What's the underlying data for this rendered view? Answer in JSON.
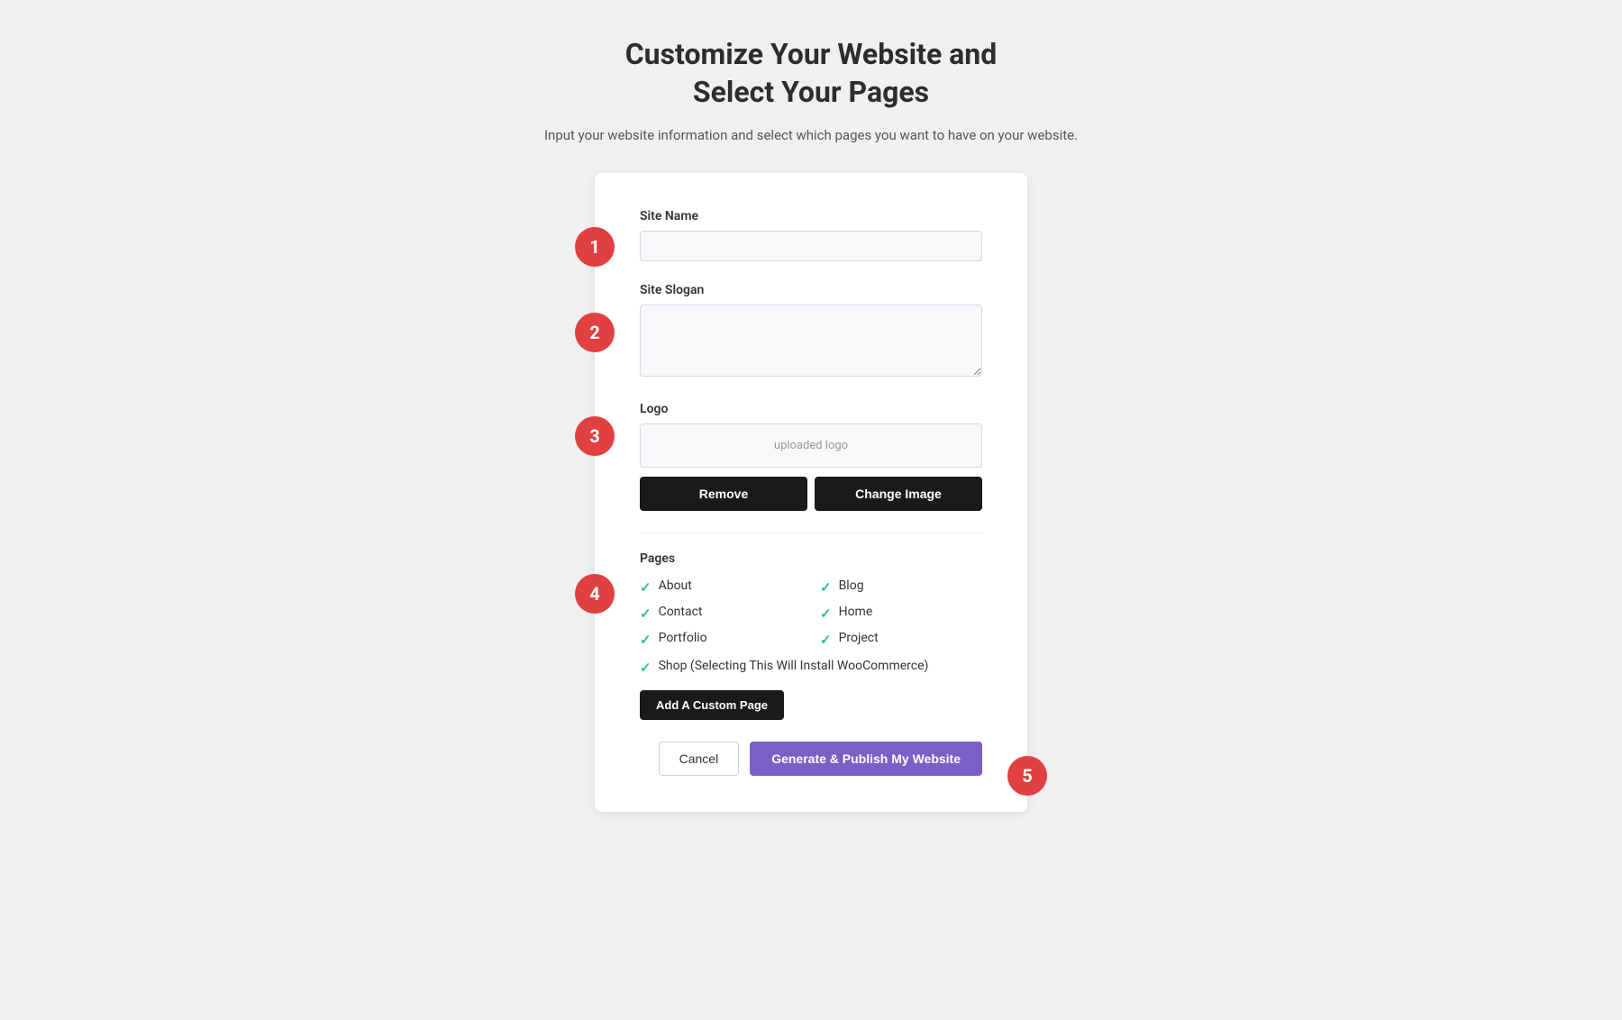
{
  "header": {
    "title_line1": "Customize Your Website and",
    "title_line2": "Select Your Pages",
    "subtitle": "Input your website information and select which pages you want to have on your website."
  },
  "form": {
    "site_name_label": "Site Name",
    "site_name_placeholder": "",
    "site_slogan_label": "Site Slogan",
    "site_slogan_placeholder": "",
    "logo_label": "Logo",
    "logo_placeholder": "uploaded logo",
    "remove_button": "Remove",
    "change_image_button": "Change Image",
    "pages_label": "Pages",
    "pages": [
      {
        "label": "About",
        "checked": true,
        "col": 1
      },
      {
        "label": "Blog",
        "checked": true,
        "col": 2
      },
      {
        "label": "Contact",
        "checked": true,
        "col": 1
      },
      {
        "label": "Home",
        "checked": true,
        "col": 2
      },
      {
        "label": "Portfolio",
        "checked": true,
        "col": 1
      },
      {
        "label": "Project",
        "checked": true,
        "col": 2
      }
    ],
    "shop_label": "Shop (Selecting This Will Install WooCommerce)",
    "shop_checked": true,
    "add_custom_page_button": "Add A Custom Page",
    "cancel_button": "Cancel",
    "publish_button": "Generate & Publish My Website"
  },
  "steps": {
    "step1": "1",
    "step2": "2",
    "step3": "3",
    "step4": "4",
    "step5": "5"
  },
  "icons": {
    "check": "✓"
  }
}
